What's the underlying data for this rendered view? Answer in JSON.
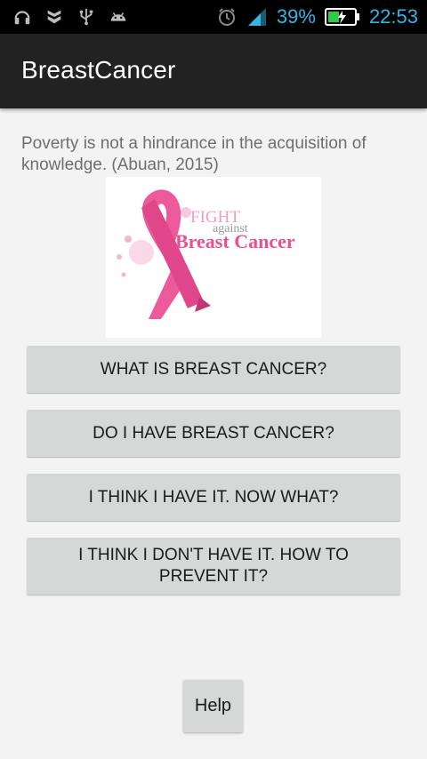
{
  "status_bar": {
    "icons_left": [
      "headphones-icon",
      "notification-shield-icon",
      "usb-icon",
      "android-debug-icon"
    ],
    "icons_right": [
      "alarm-icon",
      "signal-icon",
      "battery-icon"
    ],
    "battery_percent": "39%",
    "time": "22:53",
    "accent_color": "#33b5e5"
  },
  "action_bar": {
    "title": "BreastCancer"
  },
  "main": {
    "quote": "Poverty is not a hindrance in the acquisition of knowledge. (Abuan, 2015)",
    "banner": {
      "line1": "FIGHT",
      "line2": "against",
      "line3": "Breast Cancer",
      "ribbon_color": "#ec5a9c"
    },
    "buttons": [
      {
        "label": "WHAT IS BREAST CANCER?"
      },
      {
        "label": "DO I HAVE BREAST CANCER?"
      },
      {
        "label": "I THINK I HAVE IT. NOW WHAT?"
      },
      {
        "label": "I THINK I DON'T HAVE IT. HOW TO PREVENT IT?"
      }
    ],
    "help_label": "Help"
  }
}
